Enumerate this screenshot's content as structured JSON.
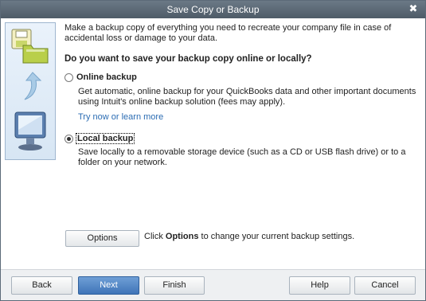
{
  "window": {
    "title": "Save Copy or Backup",
    "close_glyph": "✖"
  },
  "intro": "Make a backup copy of everything you need to recreate your company file in case of accidental loss or damage to your data.",
  "question": "Do you want to save your backup copy online or locally?",
  "online": {
    "label": "Online backup",
    "selected": false,
    "description": "Get automatic, online backup for your QuickBooks data and other important documents using Intuit's online backup solution (fees may apply).",
    "link": "Try now or learn more"
  },
  "local": {
    "label": "Local backup",
    "selected": true,
    "description": "Save locally to a removable storage device (such as a CD or USB flash drive) or to a folder on your network."
  },
  "options": {
    "button_label": "Options",
    "hint_prefix": "Click ",
    "hint_bold": "Options",
    "hint_suffix": " to change your current backup settings."
  },
  "footer": {
    "back": "Back",
    "next": "Next",
    "finish": "Finish",
    "help": "Help",
    "cancel": "Cancel"
  },
  "icons": [
    "floppy-folder-icon",
    "arrow-icon",
    "monitor-icon",
    "close-icon"
  ],
  "colors": {
    "titlebar": "#5a6774",
    "link": "#2b6cb3",
    "primary_button": "#3f74b8"
  }
}
